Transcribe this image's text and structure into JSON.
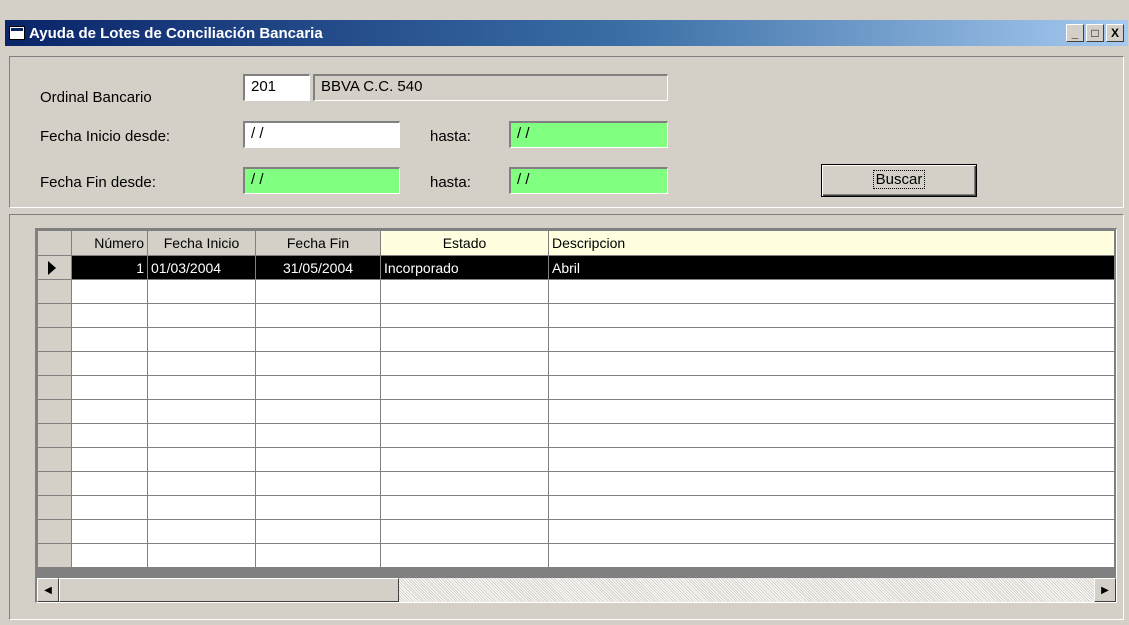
{
  "window": {
    "title": "Ayuda de Lotes de Conciliación Bancaria",
    "minimize": "_",
    "maximize": "□",
    "close": "X"
  },
  "filters": {
    "ordinal_label": "Ordinal Bancario",
    "ordinal_value": "201",
    "ordinal_name": "BBVA C.C. 540",
    "fecha_inicio_label": "Fecha Inicio desde:",
    "fecha_inicio_desde": "/ /",
    "fecha_inicio_hasta_label": "hasta:",
    "fecha_inicio_hasta": "/ /",
    "fecha_fin_label": "Fecha Fin desde:",
    "fecha_fin_desde": "/ /",
    "fecha_fin_hasta_label": "hasta:",
    "fecha_fin_hasta": "/ /",
    "buscar_label": "Buscar"
  },
  "grid": {
    "columns": [
      "Número",
      "Fecha Inicio",
      "Fecha Fin",
      "Estado",
      "Descripcion"
    ],
    "rows": [
      {
        "numero": "1",
        "fecha_inicio": "01/03/2004",
        "fecha_fin": "31/05/2004",
        "estado": "Incorporado",
        "descripcion": "Abril"
      }
    ]
  },
  "colors": {
    "title_gradient_start": "#0a246a",
    "green_field": "#80ff80",
    "selected_row": "#000000",
    "face": "#d4d0c8"
  }
}
